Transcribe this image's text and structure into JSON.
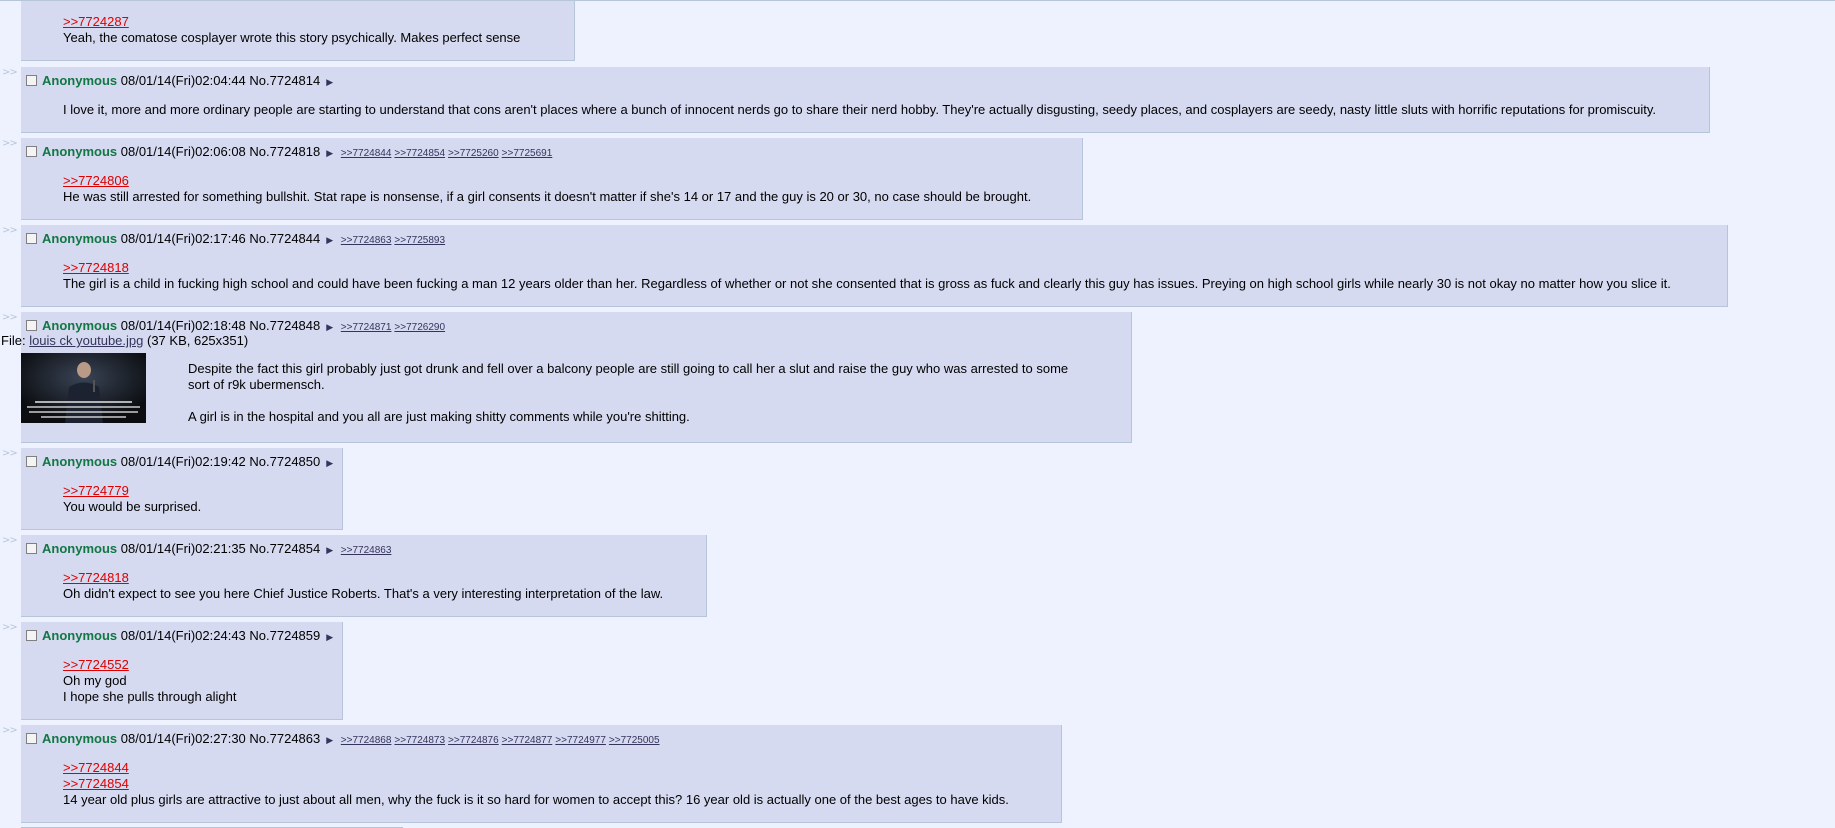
{
  "colors": {
    "background": "#eef2ff",
    "post_bg": "#d6daf0",
    "border": "#b7c5d9",
    "name": "#117743",
    "quotelink": "#dd0000",
    "backlink": "#34345c"
  },
  "post_arrow": ">>",
  "triangle_icon": "▶",
  "posts": [
    {
      "quotes": [
        ">>7724287"
      ],
      "lines": [
        "Yeah, the comatose cosplayer wrote this story psychically. Makes perfect sense"
      ]
    },
    {
      "name": "Anonymous",
      "date": "08/01/14(Fri)02:04:44",
      "no": "No.7724814",
      "backlinks": [],
      "lines": [
        "I love it, more and more ordinary people are starting to understand that cons aren't places where a bunch of innocent nerds go to share their nerd hobby. They're actually disgusting, seedy places, and cosplayers are seedy, nasty little sluts with horrific reputations for promiscuity."
      ]
    },
    {
      "name": "Anonymous",
      "date": "08/01/14(Fri)02:06:08",
      "no": "No.7724818",
      "backlinks": [
        ">>7724844",
        ">>7724854",
        ">>7725260",
        ">>7725691"
      ],
      "quotes": [
        ">>7724806"
      ],
      "lines": [
        "He was still arrested for something bullshit. Stat rape is nonsense, if a girl consents it doesn't matter if she's 14 or 17 and the guy is 20 or 30, no case should be brought."
      ]
    },
    {
      "name": "Anonymous",
      "date": "08/01/14(Fri)02:17:46",
      "no": "No.7724844",
      "backlinks": [
        ">>7724863",
        ">>7725893"
      ],
      "quotes": [
        ">>7724818"
      ],
      "lines": [
        "The girl is a child in fucking high school and could have been fucking a man 12 years older than her. Regardless of whether or not she consented that is gross as fuck and clearly this guy has issues. Preying on high school girls while nearly 30 is not okay no matter how you slice it."
      ]
    },
    {
      "name": "Anonymous",
      "date": "08/01/14(Fri)02:18:48",
      "no": "No.7724848",
      "backlinks": [
        ">>7724871",
        ">>7726290"
      ],
      "file": {
        "label": "File:",
        "name": "louis ck youtube.jpg",
        "meta": "(37 KB, 625x351)"
      },
      "lines": [
        "Despite the fact this girl probably just got drunk and fell over a balcony people are still going to call her a slut and raise the guy who was arrested to some",
        "sort of r9k ubermensch.",
        "",
        "A girl is in the hospital and you all are just making shitty comments while you're shitting."
      ]
    },
    {
      "name": "Anonymous",
      "date": "08/01/14(Fri)02:19:42",
      "no": "No.7724850",
      "backlinks": [],
      "quotes": [
        ">>7724779"
      ],
      "lines": [
        "You would be surprised."
      ]
    },
    {
      "name": "Anonymous",
      "date": "08/01/14(Fri)02:21:35",
      "no": "No.7724854",
      "backlinks": [
        ">>7724863"
      ],
      "quotes": [
        ">>7724818"
      ],
      "lines": [
        "Oh didn't expect to see you here Chief Justice Roberts. That's a very interesting interpretation of the law."
      ]
    },
    {
      "name": "Anonymous",
      "date": "08/01/14(Fri)02:24:43",
      "no": "No.7724859",
      "backlinks": [],
      "quotes": [
        ">>7724552"
      ],
      "lines": [
        "Oh my god",
        "I hope she pulls through alight"
      ]
    },
    {
      "name": "Anonymous",
      "date": "08/01/14(Fri)02:27:30",
      "no": "No.7724863",
      "backlinks": [
        ">>7724868",
        ">>7724873",
        ">>7724876",
        ">>7724877",
        ">>7724977",
        ">>7725005"
      ],
      "quotes": [
        ">>7724844",
        ">>7724854"
      ],
      "lines": [
        "14 year old plus girls are attractive to just about all men, why the fuck is it so hard for women to accept this? 16 year old is actually one of the best ages to have kids."
      ]
    }
  ]
}
